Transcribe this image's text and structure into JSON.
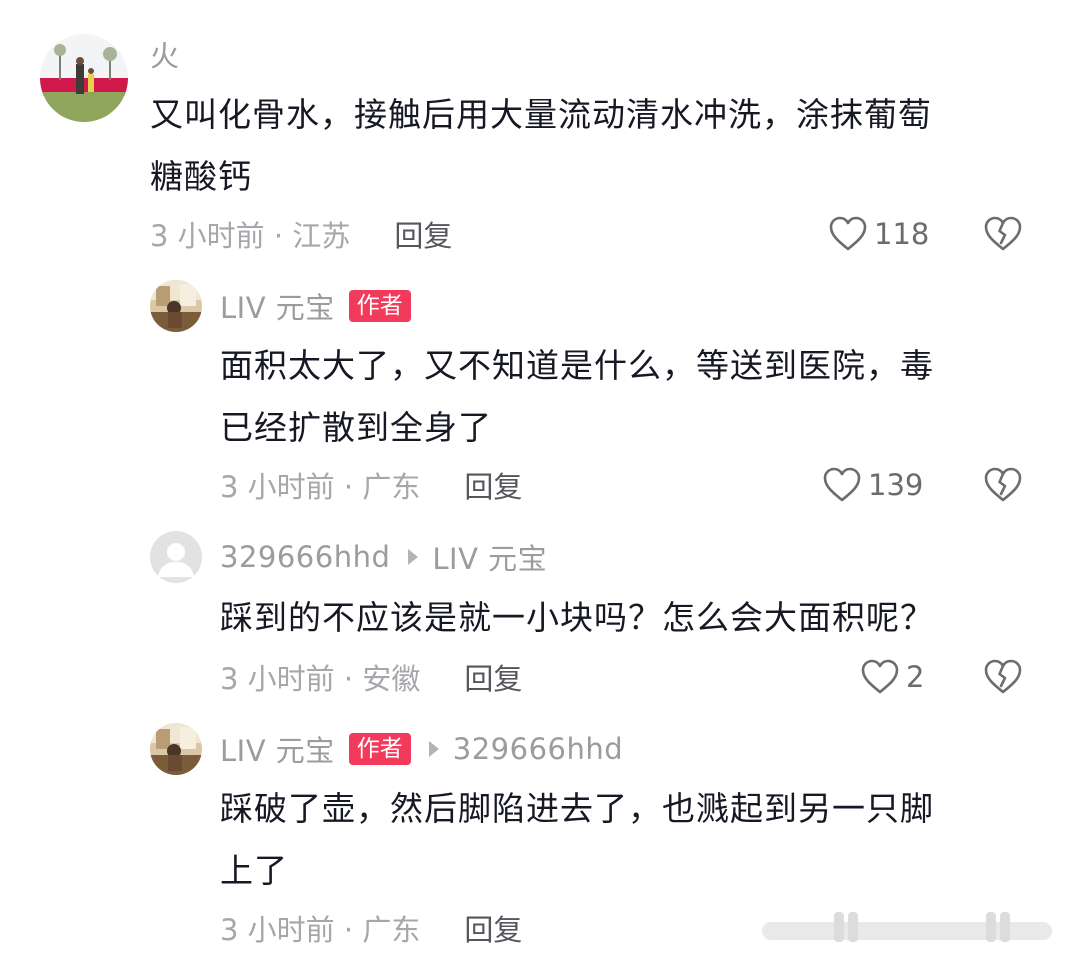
{
  "comments": [
    {
      "username": "火",
      "text_line1": "又叫化骨水，接触后用大量流动清水冲洗，涂抹葡萄",
      "text_line2": "糖酸钙",
      "time_location": "3 小时前 · 江苏",
      "reply_label": "回复",
      "likes": "118"
    },
    {
      "username": "LIV 元宝",
      "badge": "作者",
      "text_line1": "面积太大了，又不知道是什么，等送到医院，毒",
      "text_line2": "已经扩散到全身了",
      "time_location": "3 小时前 · 广东",
      "reply_label": "回复",
      "likes": "139"
    },
    {
      "username": "329666hhd",
      "reply_to": "LIV 元宝",
      "text_line1": "踩到的不应该是就一小块吗？怎么会大面积呢？",
      "time_location": "3 小时前 · 安徽",
      "reply_label": "回复",
      "likes": "2"
    },
    {
      "username": "LIV 元宝",
      "badge": "作者",
      "reply_to": "329666hhd",
      "text_line1": "踩破了壶，然后脚陷进去了，也溅起到另一只脚",
      "text_line2": "上了",
      "time_location": "3 小时前 · 广东",
      "reply_label": "回复"
    }
  ],
  "icons": {
    "like": "heart-outline-icon",
    "dislike": "broken-heart-icon",
    "reply_arrow": "triangle-right-icon"
  },
  "colors": {
    "author_badge": "#f23a5b",
    "muted_text": "#9b9ba0",
    "body_text": "#161823"
  }
}
